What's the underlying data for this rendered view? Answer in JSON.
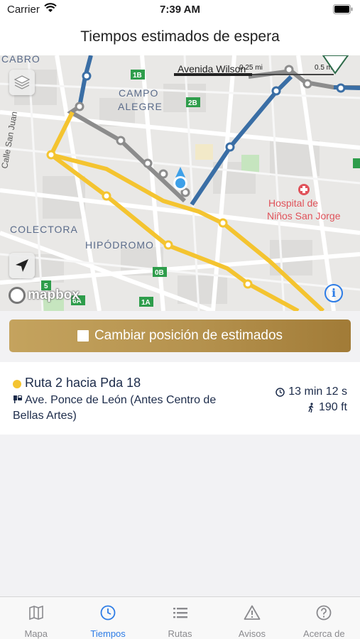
{
  "status_bar": {
    "carrier": "Carrier",
    "time": "7:39 AM"
  },
  "header": {
    "title": "Tiempos estimados de espera"
  },
  "map": {
    "labels": {
      "cabro": "CABRO",
      "campo": "CAMPO",
      "alegre": "ALEGRE",
      "colectora": "COLECTORA",
      "hipodromo": "HIPÓDROMO",
      "calle": "Calle San Juan",
      "hospital1": "Hospital de",
      "hospital2": "Niños San Jorge",
      "avenida": "Avenida Wilson"
    },
    "scale": {
      "a": "0.25 mi",
      "b": "0.5 mi"
    },
    "shields": {
      "s1b": "1B",
      "s2b": "2B",
      "s0b": "0B",
      "s1a": "1A",
      "s6a": "6A",
      "s5": "5"
    },
    "attribution": "mapbox",
    "info_glyph": "i"
  },
  "action_button": {
    "label": "Cambiar posición de estimados",
    "checked": false
  },
  "estimate": {
    "route": "Ruta 2 hacia Pda 18",
    "route_color": "#f4c430",
    "stop": "Ave. Ponce de León (Antes Centro de Bellas Artes)",
    "time": "13 min 12 s",
    "distance": "190 ft"
  },
  "tabs": [
    {
      "label": "Mapa",
      "icon": "map-icon",
      "active": false
    },
    {
      "label": "Tiempos",
      "icon": "clock-icon",
      "active": true
    },
    {
      "label": "Rutas",
      "icon": "list-icon",
      "active": false
    },
    {
      "label": "Avisos",
      "icon": "warning-icon",
      "active": false
    },
    {
      "label": "Acerca de",
      "icon": "help-icon",
      "active": false
    }
  ],
  "colors": {
    "accent": "#2d7ce6",
    "gold": "#b5924e",
    "yellow_route": "#f4c430",
    "blue_route": "#3a6ea5",
    "gray_route": "#8c8c8c"
  }
}
